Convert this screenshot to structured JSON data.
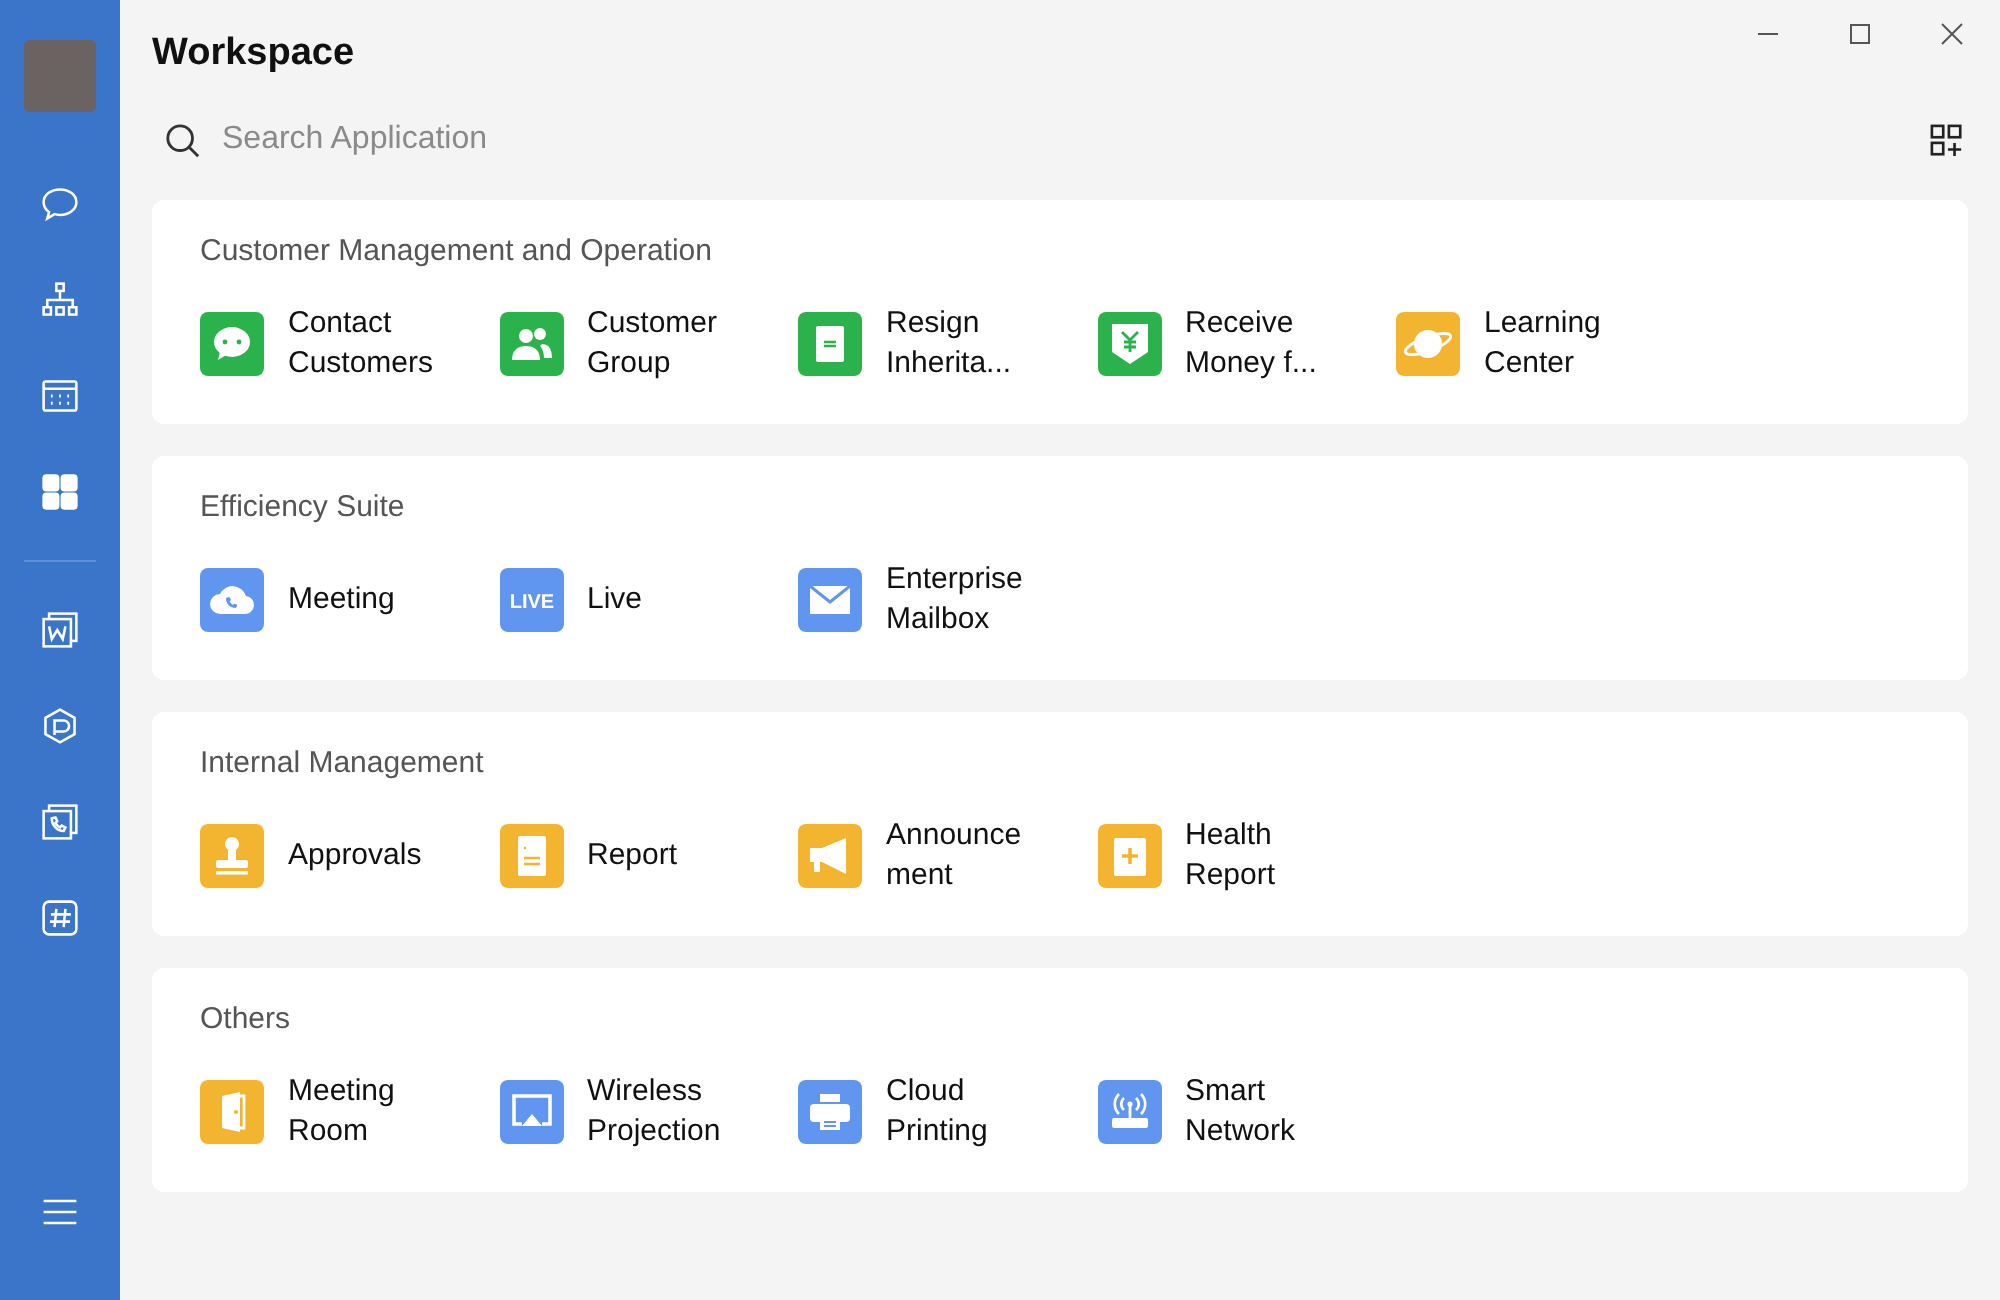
{
  "window": {
    "title": "Workspace"
  },
  "sidebar": {
    "items": [
      {
        "kind": "chat",
        "selected": false
      },
      {
        "kind": "org",
        "selected": false
      },
      {
        "kind": "calendar",
        "selected": false
      },
      {
        "kind": "apps",
        "selected": true
      }
    ],
    "tools": [
      {
        "kind": "doc",
        "selected": false
      },
      {
        "kind": "hexagon",
        "selected": false
      },
      {
        "kind": "phone",
        "selected": false
      },
      {
        "kind": "hash",
        "selected": false
      }
    ]
  },
  "search": {
    "placeholder": "Search Application"
  },
  "sections": [
    {
      "title": "Customer Management and Operation",
      "apps": [
        {
          "lines": [
            "Contact",
            "Customers"
          ],
          "kind": "chat",
          "color": "#2bb24c"
        },
        {
          "lines": [
            "Customer",
            "Group"
          ],
          "kind": "people",
          "color": "#2bb24c"
        },
        {
          "lines": [
            "Resign",
            "Inherita..."
          ],
          "kind": "transfer",
          "color": "#2bb24c"
        },
        {
          "lines": [
            "Receive",
            "Money f..."
          ],
          "kind": "yen",
          "color": "#2bb24c"
        },
        {
          "lines": [
            "Learning",
            "Center"
          ],
          "kind": "planet",
          "color": "#f3b530"
        }
      ]
    },
    {
      "title": "Efficiency Suite",
      "apps": [
        {
          "lines": [
            "Meeting"
          ],
          "kind": "cloud",
          "color": "#6196f0"
        },
        {
          "lines": [
            "Live"
          ],
          "kind": "badge",
          "badge": "LIVE",
          "color": "#6196f0"
        },
        {
          "lines": [
            "Enterprise",
            "Mailbox"
          ],
          "kind": "mail",
          "color": "#6196f0"
        }
      ]
    },
    {
      "title": "Internal Management",
      "apps": [
        {
          "lines": [
            "Approvals"
          ],
          "kind": "stamp",
          "color": "#f3b530"
        },
        {
          "lines": [
            "Report"
          ],
          "kind": "report",
          "color": "#f3b530"
        },
        {
          "lines": [
            "Announce",
            "ment"
          ],
          "kind": "megaphone",
          "color": "#f3b530"
        },
        {
          "lines": [
            "Health",
            "Report"
          ],
          "kind": "health",
          "color": "#f3b530"
        }
      ]
    },
    {
      "title": "Others",
      "apps": [
        {
          "lines": [
            "Meeting",
            "Room"
          ],
          "kind": "door",
          "color": "#f3b530"
        },
        {
          "lines": [
            "Wireless",
            "Projection"
          ],
          "kind": "screen",
          "color": "#6196f0"
        },
        {
          "lines": [
            "Cloud",
            "Printing"
          ],
          "kind": "printer",
          "color": "#6196f0"
        },
        {
          "lines": [
            "Smart",
            "Network"
          ],
          "kind": "router",
          "color": "#6196f0"
        }
      ]
    }
  ]
}
